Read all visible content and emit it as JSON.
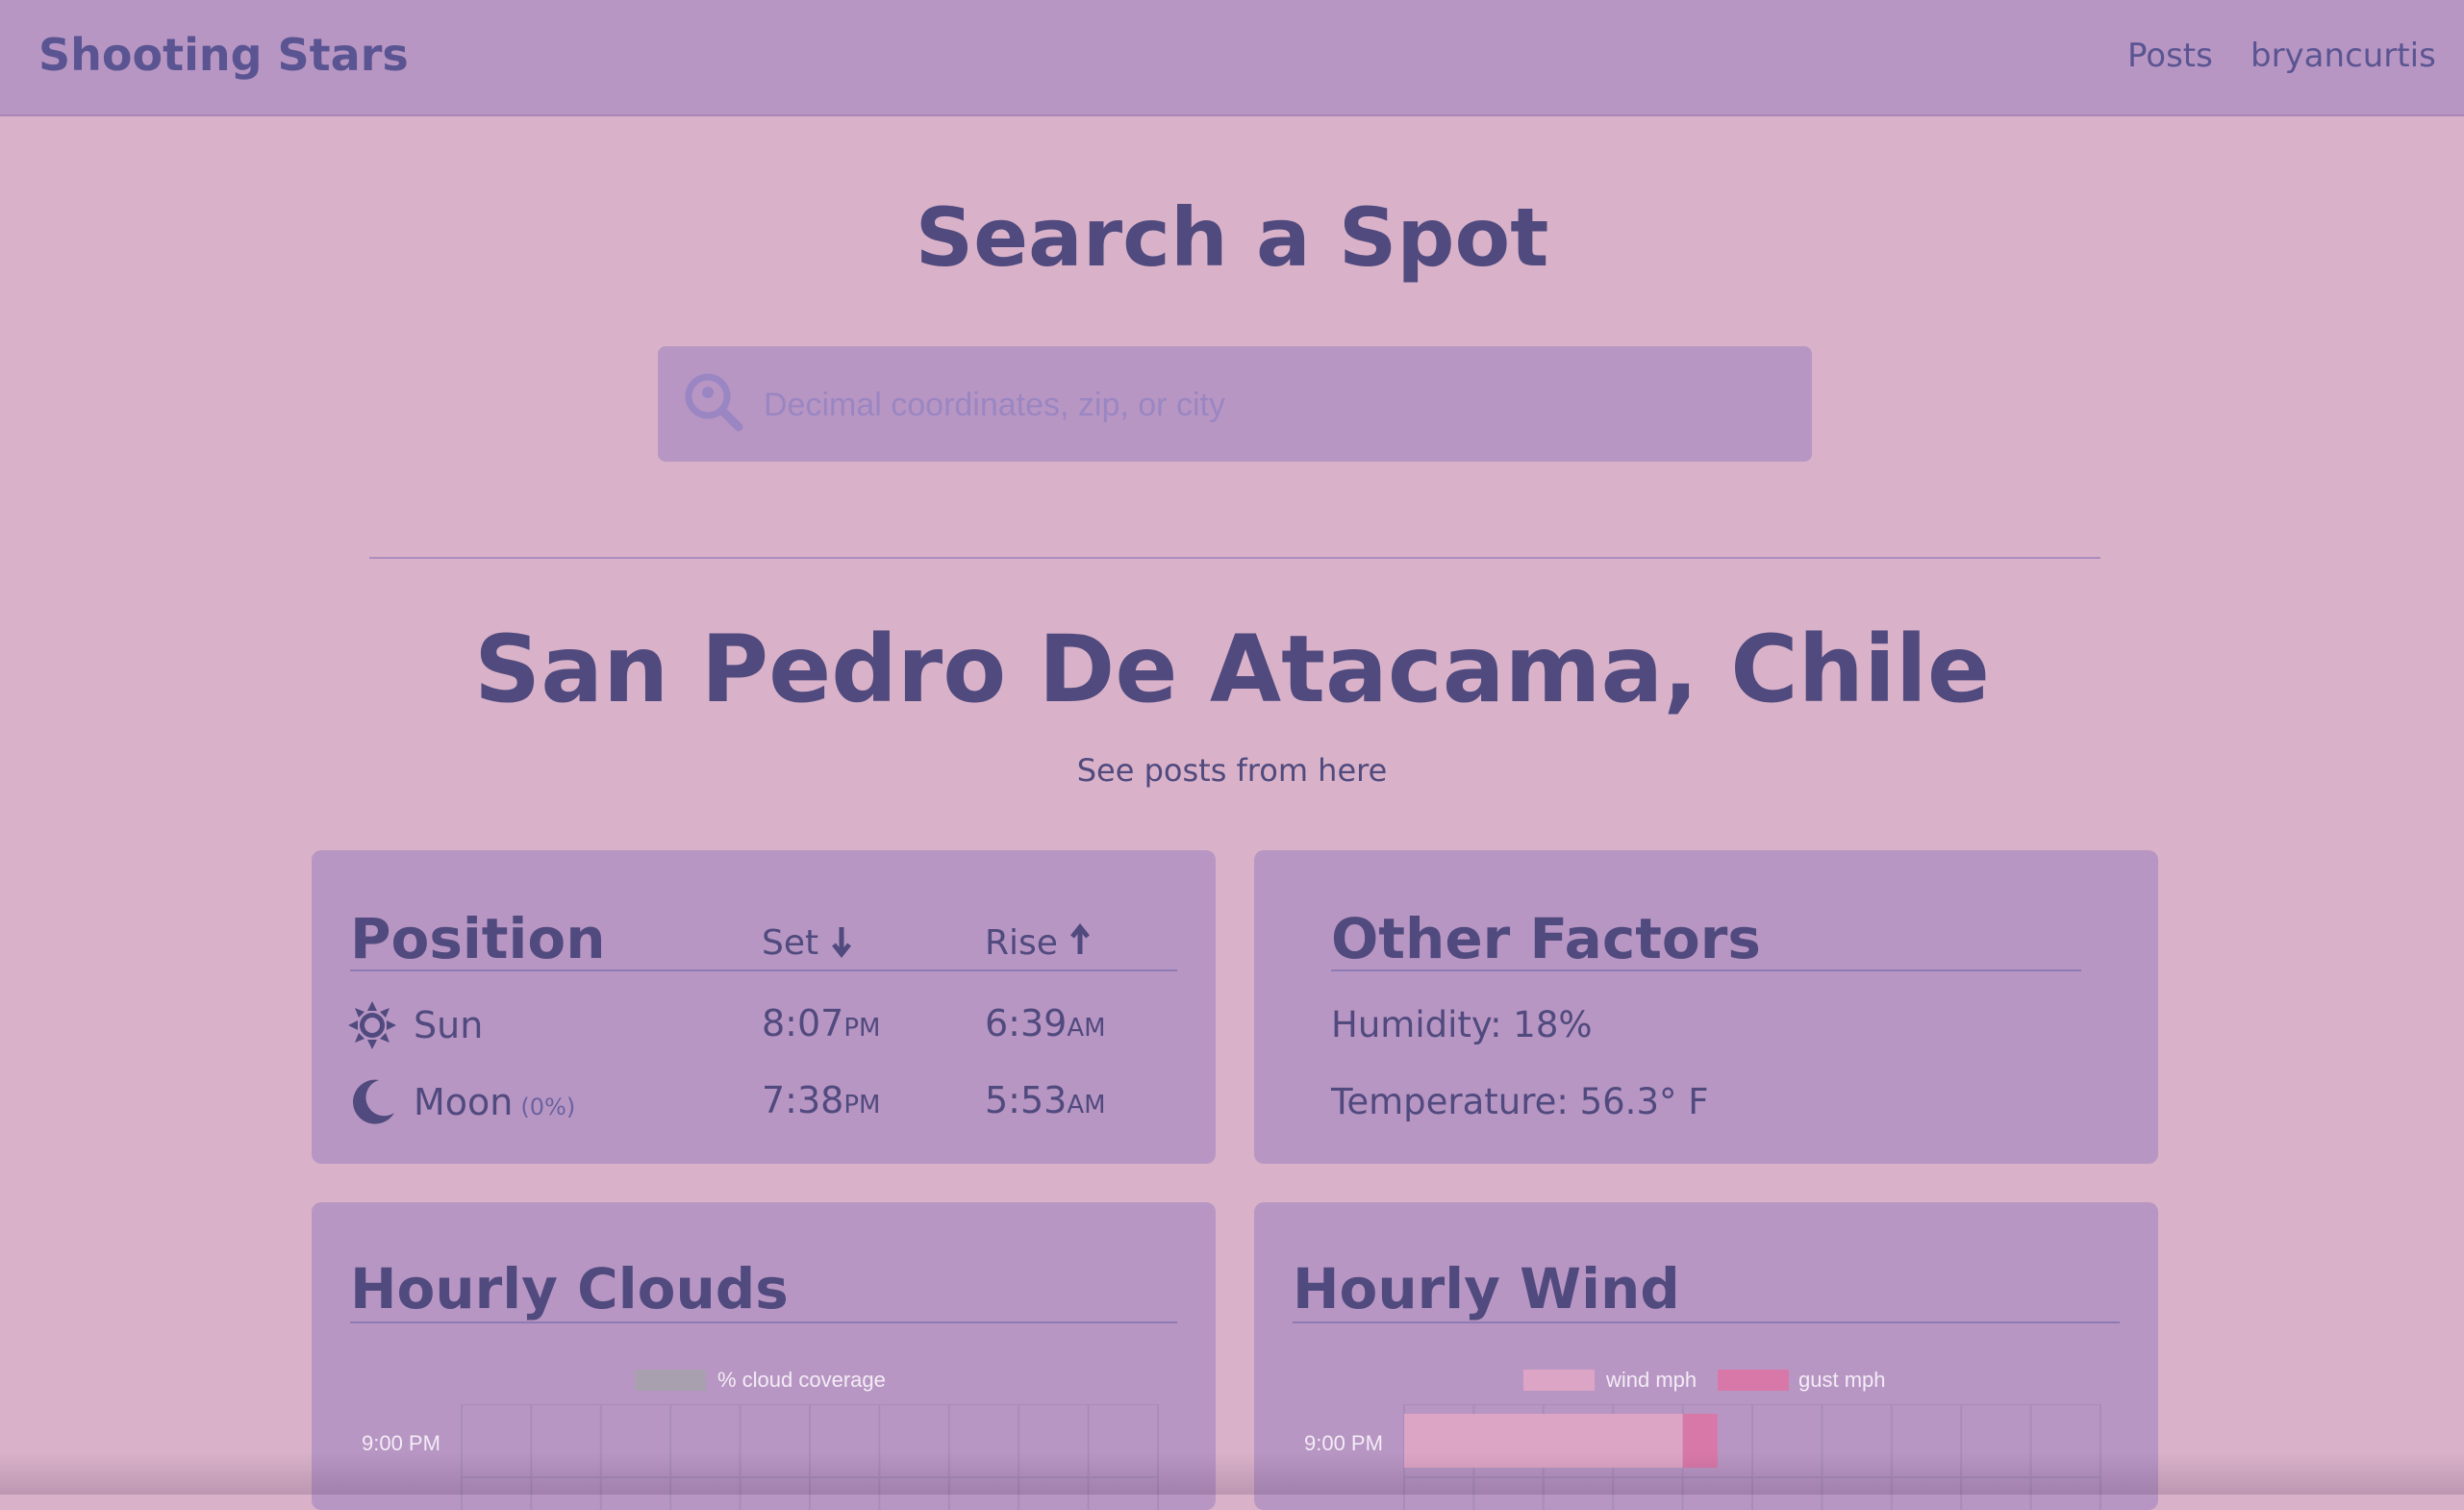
{
  "nav": {
    "brand": "Shooting Stars",
    "links": [
      "Posts",
      "bryancurtis"
    ]
  },
  "search": {
    "title": "Search a Spot",
    "placeholder": "Decimal coordinates, zip, or city",
    "icon": "location-search-icon"
  },
  "location": {
    "name": "San Pedro De Atacama, Chile",
    "posts_link": "See posts from here"
  },
  "position": {
    "title": "Position",
    "set_label": "Set",
    "rise_label": "Rise",
    "rows": [
      {
        "name": "Sun",
        "icon": "sun-icon",
        "extra": "",
        "set_time": "8:07",
        "set_ampm": "PM",
        "rise_time": "6:39",
        "rise_ampm": "AM"
      },
      {
        "name": "Moon",
        "icon": "moon-icon",
        "extra": "(0%)",
        "set_time": "7:38",
        "set_ampm": "PM",
        "rise_time": "5:53",
        "rise_ampm": "AM"
      }
    ]
  },
  "other_factors": {
    "title": "Other Factors",
    "humidity": "Humidity: 18%",
    "temperature": "Temperature: 56.3° F"
  },
  "colors": {
    "page_bg": "#d9b2c9",
    "card_bg": "#b896c3",
    "text": "#504a7e",
    "cloud_series": "#a8a0ae",
    "wind_series": "#dda5c5",
    "gust_series": "#d878a8"
  },
  "chart_data": [
    {
      "type": "bar",
      "title": "Hourly Clouds",
      "orientation": "horizontal",
      "series": [
        {
          "name": "% cloud coverage",
          "values": [
            0
          ]
        }
      ],
      "categories": [
        "9:00 PM"
      ],
      "grid": true,
      "legend": "top-center"
    },
    {
      "type": "bar",
      "title": "Hourly Wind",
      "orientation": "horizontal",
      "series": [
        {
          "name": "wind mph",
          "values": [
            16
          ]
        },
        {
          "name": "gust mph",
          "values": [
            18
          ]
        }
      ],
      "categories": [
        "9:00 PM"
      ],
      "xlim": [
        0,
        40
      ],
      "grid": true,
      "legend": "top-center"
    }
  ]
}
